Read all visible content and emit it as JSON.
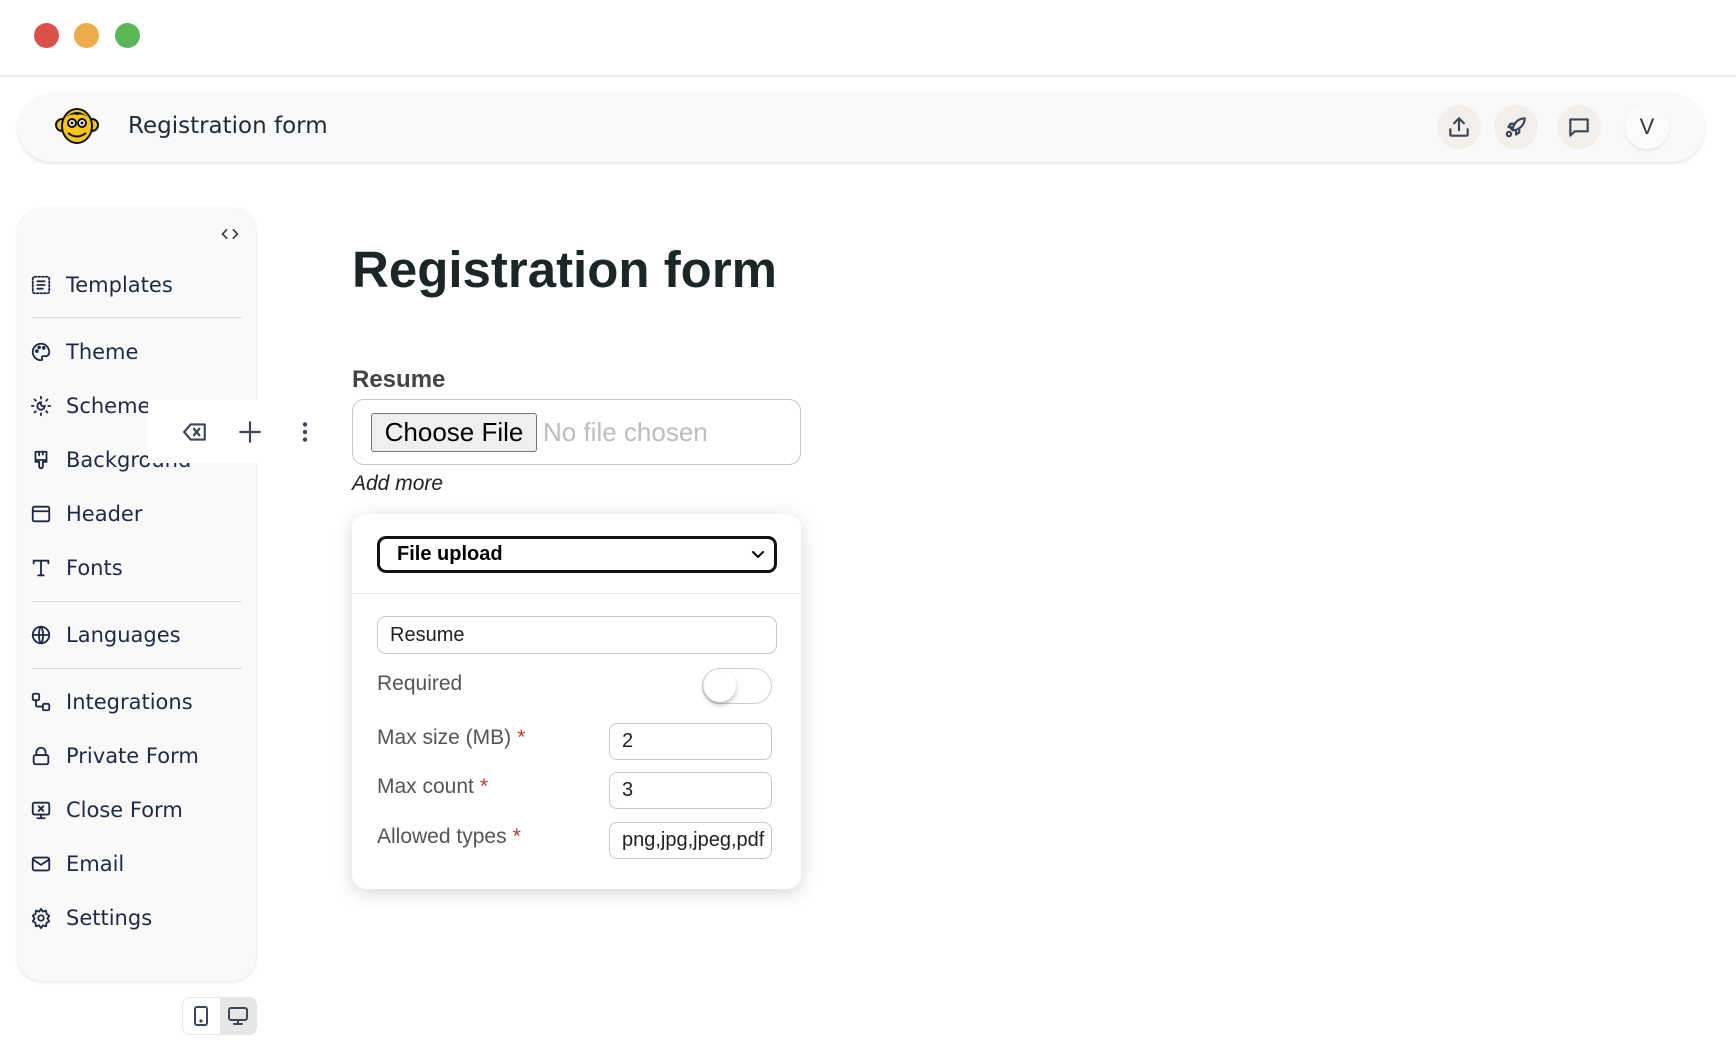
{
  "window": {
    "controls": [
      "close",
      "minimize",
      "maximize"
    ]
  },
  "header": {
    "logo_icon": "monkey-logo-icon",
    "title": "Registration form",
    "actions": [
      {
        "name": "export",
        "icon": "upload-icon"
      },
      {
        "name": "publish",
        "icon": "rocket-icon"
      },
      {
        "name": "feedback",
        "icon": "chat-icon"
      }
    ],
    "avatar_initial": "V"
  },
  "sidebar": {
    "collapse_icon": "code-brackets-icon",
    "items": [
      {
        "label": "Templates",
        "icon": "templates-icon"
      },
      {
        "label": "Theme",
        "icon": "palette-icon"
      },
      {
        "label": "Scheme",
        "icon": "sun-moon-icon"
      },
      {
        "label": "Background",
        "icon": "paintbrush-icon"
      },
      {
        "label": "Header",
        "icon": "header-layout-icon"
      },
      {
        "label": "Fonts",
        "icon": "type-icon"
      },
      {
        "label": "Languages",
        "icon": "globe-icon"
      },
      {
        "label": "Integrations",
        "icon": "integrations-icon"
      },
      {
        "label": "Private Form",
        "icon": "lock-icon"
      },
      {
        "label": "Close Form",
        "icon": "monitor-x-icon"
      },
      {
        "label": "Email",
        "icon": "mail-icon"
      },
      {
        "label": "Settings",
        "icon": "gear-icon"
      }
    ]
  },
  "field_toolbar": {
    "actions": [
      {
        "name": "delete",
        "icon": "backspace-icon"
      },
      {
        "name": "add",
        "icon": "plus-icon"
      },
      {
        "name": "more",
        "icon": "more-vertical-icon"
      }
    ]
  },
  "device_toggle": {
    "options": [
      {
        "name": "mobile",
        "icon": "tablet-icon",
        "active": false
      },
      {
        "name": "desktop",
        "icon": "monitor-icon",
        "active": true
      }
    ]
  },
  "form": {
    "title": "Registration form",
    "field": {
      "label": "Resume",
      "button_label": "Choose File",
      "status": "No file chosen",
      "add_more": "Add more"
    }
  },
  "field_editor": {
    "type_selected": "File upload",
    "name_value": "Resume",
    "required_label": "Required",
    "required_on": false,
    "max_size_label": "Max size (MB)",
    "max_size_value": "2",
    "max_count_label": "Max count",
    "max_count_value": "3",
    "allowed_types_label": "Allowed types",
    "allowed_types_value": "png,jpg,jpeg,pdf",
    "required_marker": "*"
  }
}
